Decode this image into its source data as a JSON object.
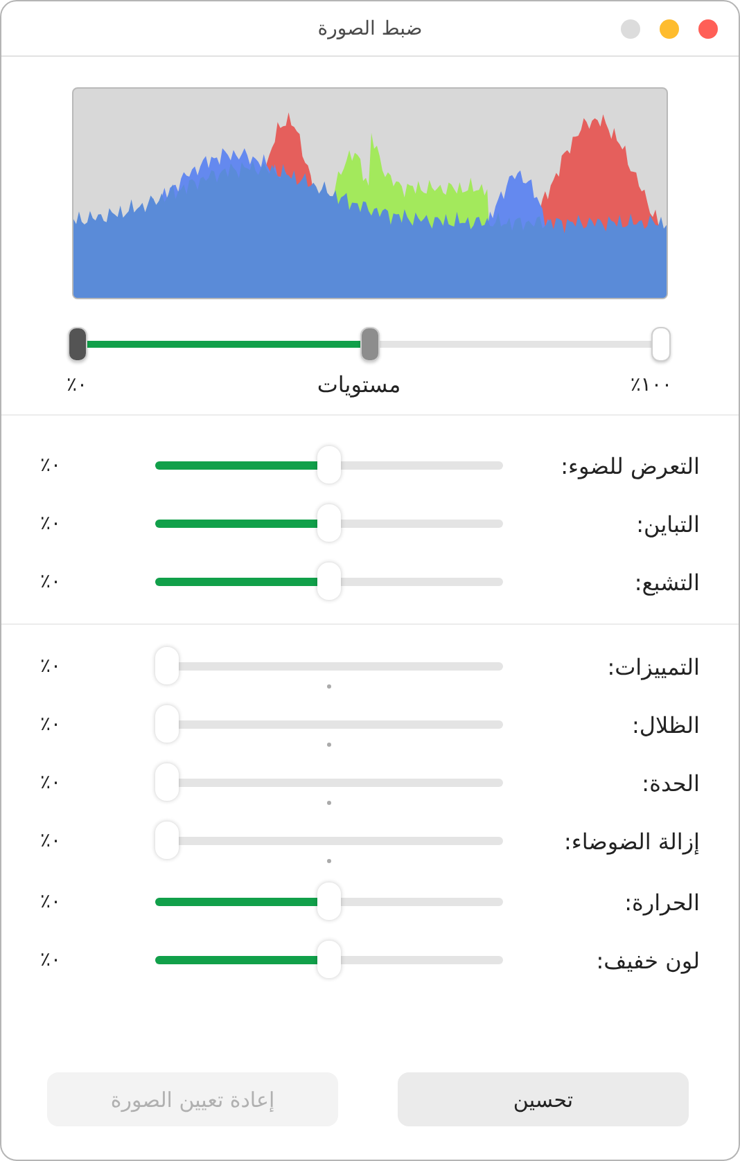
{
  "window": {
    "title": "ضبط الصورة"
  },
  "levels": {
    "label": "مستويات",
    "min_label": "٪٠",
    "max_label": "٪١٠٠",
    "thumbs": [
      {
        "level": 0
      },
      {
        "level": 0.5
      },
      {
        "level": 1
      }
    ]
  },
  "sections": [
    {
      "rows": [
        {
          "label": "التعرض للضوء:",
          "kind": "centered",
          "level": 0.5,
          "reading": "٪٠"
        },
        {
          "label": "التباين:",
          "kind": "centered",
          "level": 0.5,
          "reading": "٪٠"
        },
        {
          "label": "التشبع:",
          "kind": "centered",
          "level": 0.5,
          "reading": "٪٠"
        }
      ]
    },
    {
      "rows": [
        {
          "label": "التمييزات:",
          "kind": "detail",
          "level": 0,
          "reading": "٪٠"
        },
        {
          "label": "الظلال:",
          "kind": "detail",
          "level": 0,
          "reading": "٪٠"
        },
        {
          "label": "الحدة:",
          "kind": "detail",
          "level": 0,
          "reading": "٪٠"
        },
        {
          "label": "إزالة الضوضاء:",
          "kind": "detail",
          "level": 0,
          "reading": "٪٠"
        }
      ]
    },
    {
      "rows": [
        {
          "label": "الحرارة:",
          "kind": "centered",
          "level": 0.5,
          "reading": "٪٠"
        },
        {
          "label": "لون خفيف:",
          "kind": "centered",
          "level": 0.5,
          "reading": "٪٠"
        }
      ]
    }
  ],
  "buttons": [
    {
      "label": "تحسين",
      "disabled": false
    },
    {
      "label": "إعادة تعيين الصورة",
      "disabled": true
    }
  ]
}
